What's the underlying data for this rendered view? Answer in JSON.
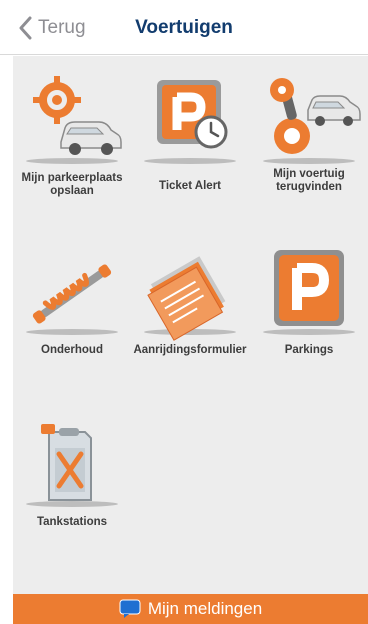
{
  "header": {
    "back_label": "Terug",
    "title": "Voertuigen"
  },
  "tiles": [
    {
      "label": "Mijn parkeerplaats opslaan",
      "icon": "save-parking-icon"
    },
    {
      "label": "Ticket Alert",
      "icon": "parking-clock-icon"
    },
    {
      "label": "Mijn voertuig terugvinden",
      "icon": "find-vehicle-icon"
    },
    {
      "label": "Onderhoud",
      "icon": "shock-absorber-icon"
    },
    {
      "label": "Aanrijdingsformulier",
      "icon": "accident-form-icon"
    },
    {
      "label": "Parkings",
      "icon": "parking-sign-icon"
    },
    {
      "label": "Tankstations",
      "icon": "fuel-can-icon"
    }
  ],
  "footer": {
    "label": "Mijn meldingen",
    "icon": "chat-bubble-icon"
  },
  "colors": {
    "accent": "#ec7c31",
    "title": "#123c6e",
    "background": "#ededed"
  }
}
